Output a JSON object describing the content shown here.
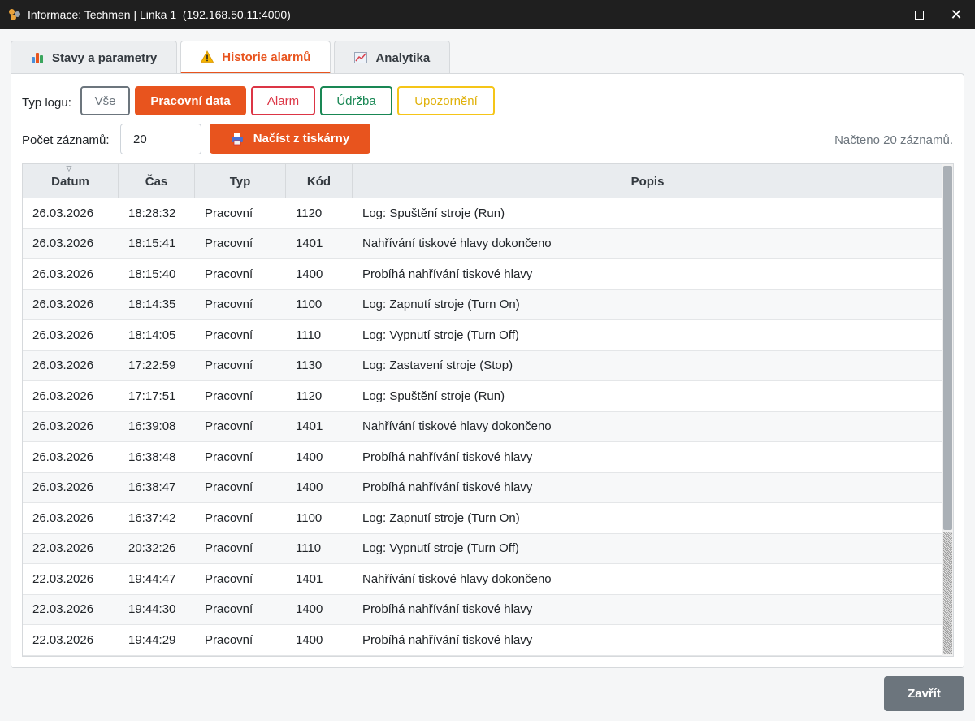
{
  "window": {
    "title": "Informace: Techmen | Linka 1  (192.168.50.11:4000)",
    "app_icon": "gears-icon"
  },
  "tabs": [
    {
      "label": "Stavy a parametry",
      "icon": "bar-chart-icon",
      "active": false
    },
    {
      "label": "Historie alarmů",
      "icon": "warning-icon",
      "active": true
    },
    {
      "label": "Analytika",
      "icon": "line-chart-icon",
      "active": false
    }
  ],
  "filters": {
    "label": "Typ logu:",
    "buttons": [
      {
        "label": "Vše",
        "color": "#6c757d",
        "selected": false
      },
      {
        "label": "Pracovní data",
        "color": "#e8541e",
        "selected": true
      },
      {
        "label": "Alarm",
        "color": "#dc3545",
        "selected": false
      },
      {
        "label": "Údržba",
        "color": "#198754",
        "selected": false
      },
      {
        "label": "Upozornění",
        "color": "#f5c518",
        "selected": false
      }
    ]
  },
  "records": {
    "label": "Počet záznamů:",
    "value": "20",
    "load_label": "Načíst z tiskárny",
    "load_icon": "printer-icon",
    "status": "Načteno 20 záznamů."
  },
  "table": {
    "headers": [
      "Datum",
      "Čas",
      "Typ",
      "Kód",
      "Popis"
    ],
    "sorted_column": "Datum",
    "rows": [
      [
        "26.03.2026",
        "18:28:32",
        "Pracovní",
        "1120",
        "Log: Spuštění stroje (Run)"
      ],
      [
        "26.03.2026",
        "18:15:41",
        "Pracovní",
        "1401",
        "Nahřívání tiskové hlavy dokončeno"
      ],
      [
        "26.03.2026",
        "18:15:40",
        "Pracovní",
        "1400",
        "Probíhá nahřívání tiskové hlavy"
      ],
      [
        "26.03.2026",
        "18:14:35",
        "Pracovní",
        "1100",
        "Log: Zapnutí stroje (Turn On)"
      ],
      [
        "26.03.2026",
        "18:14:05",
        "Pracovní",
        "1110",
        "Log: Vypnutí stroje (Turn Off)"
      ],
      [
        "26.03.2026",
        "17:22:59",
        "Pracovní",
        "1130",
        "Log: Zastavení stroje (Stop)"
      ],
      [
        "26.03.2026",
        "17:17:51",
        "Pracovní",
        "1120",
        "Log: Spuštění stroje (Run)"
      ],
      [
        "26.03.2026",
        "16:39:08",
        "Pracovní",
        "1401",
        "Nahřívání tiskové hlavy dokončeno"
      ],
      [
        "26.03.2026",
        "16:38:48",
        "Pracovní",
        "1400",
        "Probíhá nahřívání tiskové hlavy"
      ],
      [
        "26.03.2026",
        "16:38:47",
        "Pracovní",
        "1400",
        "Probíhá nahřívání tiskové hlavy"
      ],
      [
        "26.03.2026",
        "16:37:42",
        "Pracovní",
        "1100",
        "Log: Zapnutí stroje (Turn On)"
      ],
      [
        "22.03.2026",
        "20:32:26",
        "Pracovní",
        "1110",
        "Log: Vypnutí stroje (Turn Off)"
      ],
      [
        "22.03.2026",
        "19:44:47",
        "Pracovní",
        "1401",
        "Nahřívání tiskové hlavy dokončeno"
      ],
      [
        "22.03.2026",
        "19:44:30",
        "Pracovní",
        "1400",
        "Probíhá nahřívání tiskové hlavy"
      ],
      [
        "22.03.2026",
        "19:44:29",
        "Pracovní",
        "1400",
        "Probíhá nahřívání tiskové hlavy"
      ]
    ]
  },
  "footer": {
    "close_label": "Zavřít"
  },
  "colors": {
    "accent": "#e8541e",
    "titlebar": "#1f1f1f",
    "close_button": "#6c757d"
  }
}
